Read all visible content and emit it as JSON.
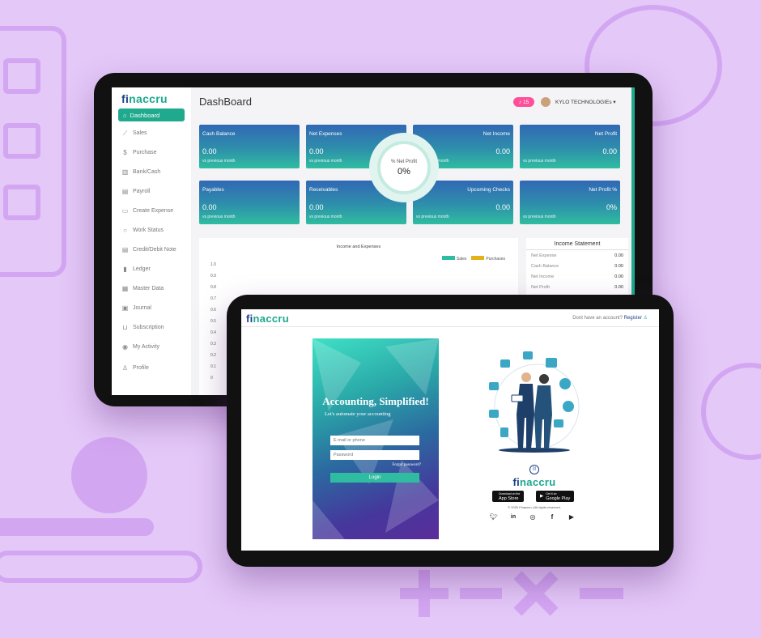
{
  "colors": {
    "accent": "#1fa98d",
    "brand_blue": "#1e3f8a",
    "background": "#e4c8f8",
    "notification": "#ff4f9a"
  },
  "dashboard": {
    "logo_prefix": "fi",
    "logo_suffix": "naccru",
    "title": "DashBoard",
    "notification_count": "15",
    "company": "KYLO TECHNOLOGIEs ▾",
    "sidebar": [
      {
        "label": "Dashboard",
        "icon": "home-icon"
      },
      {
        "label": "Sales",
        "icon": "chart-icon"
      },
      {
        "label": "Purchase",
        "icon": "dollar-icon"
      },
      {
        "label": "Bank/Cash",
        "icon": "bank-icon"
      },
      {
        "label": "Payroll",
        "icon": "document-icon"
      },
      {
        "label": "Create Expense",
        "icon": "money-icon"
      },
      {
        "label": "Work Status",
        "icon": "refresh-icon"
      },
      {
        "label": "Credit/Debit Note",
        "icon": "note-icon"
      },
      {
        "label": "Ledger",
        "icon": "book-icon"
      },
      {
        "label": "Master Data",
        "icon": "files-icon"
      },
      {
        "label": "Journal",
        "icon": "journal-icon"
      },
      {
        "label": "Subscription",
        "icon": "cart-icon"
      },
      {
        "label": "My Activity",
        "icon": "activity-icon"
      },
      {
        "label": "Profile",
        "icon": "user-icon"
      }
    ],
    "cards": [
      {
        "label": "Cash Balance",
        "value": "0.00",
        "sub": "vs previous month"
      },
      {
        "label": "Net Expenses",
        "value": "0.00",
        "sub": "vs previous month"
      },
      {
        "label": "Net Income",
        "value": "0.00",
        "sub": "vs previous month"
      },
      {
        "label": "Net Profit",
        "value": "0.00",
        "sub": "vs previous month"
      },
      {
        "label": "Payables",
        "value": "0.00",
        "sub": "vs previous month"
      },
      {
        "label": "Receivables",
        "value": "0.00",
        "sub": "vs previous month"
      },
      {
        "label": "Upcoming Checks",
        "value": "0.00",
        "sub": "vs previous month"
      },
      {
        "label": "Net Profit %",
        "value": "0%",
        "sub": "vs previous month"
      }
    ],
    "net_profit_ring": {
      "label": "% Net Profit",
      "value": "0%"
    },
    "chart_data": {
      "type": "bar",
      "title": "Income and Expenses",
      "series": [
        {
          "name": "Sales",
          "color": "#2fbca0",
          "values": []
        },
        {
          "name": "Purchases",
          "color": "#e2b21a",
          "values": []
        }
      ],
      "ylim": [
        0,
        1.0
      ],
      "yticks": [
        "1.0",
        "0.9",
        "0.8",
        "0.7",
        "0.6",
        "0.5",
        "0.4",
        "0.3",
        "0.2",
        "0.1",
        "0"
      ]
    },
    "income_statement": {
      "title": "Income Statement",
      "rows": [
        {
          "label": "Net Expense",
          "value": "0.00"
        },
        {
          "label": "Cash Balance",
          "value": "0.00"
        },
        {
          "label": "Net Income",
          "value": "0.00"
        },
        {
          "label": "Net Profit",
          "value": "0.00"
        }
      ]
    }
  },
  "login": {
    "logo_prefix": "fi",
    "logo_suffix": "naccru",
    "register_prompt": "Dont have an account?",
    "register_link": "Register",
    "heading": "Accounting, Simplified!",
    "subheading": "Let's automate your accounting",
    "email_placeholder": "E-mail or phone",
    "password_placeholder": "Password",
    "forgot": "Forgot password?",
    "login_button": "Login",
    "app_store_small": "Download on the",
    "app_store": "App Store",
    "google_play_small": "Get it on",
    "google_play": "Google Play",
    "copyright": "© 2020 Finaccru | All rights reserved.",
    "social": [
      "twitter-icon",
      "linkedin-icon",
      "instagram-icon",
      "facebook-icon",
      "youtube-icon"
    ]
  }
}
